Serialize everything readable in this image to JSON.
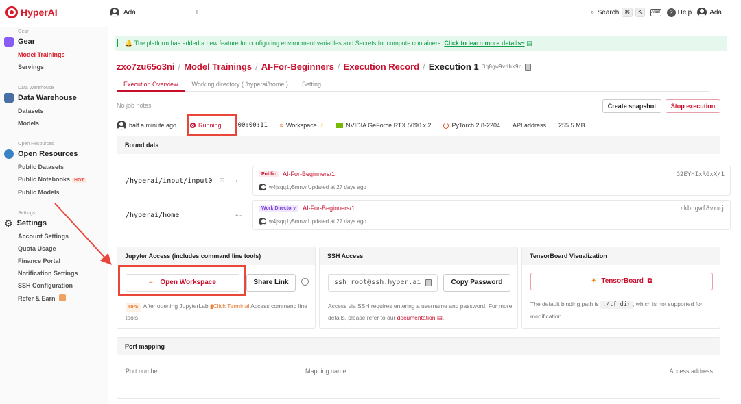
{
  "brand": {
    "name": "HyperAI"
  },
  "topbar": {
    "user": "Ada",
    "search_label": "Search",
    "shortcut_keys": [
      "⌘",
      "K"
    ],
    "help_label": "Help",
    "account_name": "Ada"
  },
  "sidebar": {
    "groups": [
      {
        "label": "Gear",
        "title": "Gear",
        "items": [
          "Model Trainings",
          "Servings"
        ],
        "active": "Model Trainings"
      },
      {
        "label": "Data Warehouse",
        "title": "Data Warehouse",
        "items": [
          "Datasets",
          "Models"
        ]
      },
      {
        "label": "Open Resources",
        "title": "Open Resources",
        "items": [
          "Public Datasets",
          "Public Notebooks",
          "Public Models"
        ],
        "hot_badge": "HOT"
      },
      {
        "label": "Settings",
        "title": "Settings",
        "items": [
          "Account Settings",
          "Quota Usage",
          "Finance Portal",
          "Notification Settings",
          "SSH Configuration",
          "Refer & Earn"
        ]
      }
    ]
  },
  "notice": {
    "text": "The platform has added a new feature for configuring environment variables and Secrets for compute containers.",
    "link": "Click to learn more details~"
  },
  "breadcrumb": {
    "items": [
      "zxo7zu65o3ni",
      "Model Trainings",
      "AI-For-Beginners",
      "Execution Record"
    ],
    "current": "Execution 1",
    "hash": "3q0gw9vdhk9c"
  },
  "tabs": [
    "Execution Overview",
    "Working directory ( /hyperai/home )",
    "Setting"
  ],
  "job_notes": "No job notes",
  "actions": {
    "snapshot": "Create snapshot",
    "stop": "Stop execution"
  },
  "status": {
    "time": "half a minute ago",
    "state": "Running",
    "elapsed": "00:00:11",
    "workspace": "Workspace",
    "gpu": "NVIDIA GeForce RTX 5090 x 2",
    "framework": "PyTorch 2.8-2204",
    "api": "API address",
    "size": "255.5 MB"
  },
  "bound_data": {
    "title": "Bound data",
    "rows": [
      {
        "path": "/hyperai/input/input0",
        "tag": "Public",
        "name": "AI-For-Beginners/1",
        "meta": "w4jsqq1y5mnw Updated at 27 days ago",
        "hash": "G2EYHIxR6xX/1"
      },
      {
        "path": "/hyperai/home",
        "tag": "Work Directory",
        "name": "AI-For-Beginners/1",
        "meta": "w4jsqq1y5mnw Updated at 27 days ago",
        "hash": "rkbqgwf8vrmj"
      }
    ]
  },
  "jupyter": {
    "title": "Jupyter Access (includes command line tools)",
    "open_label": "Open Workspace",
    "share_label": "Share Link",
    "tips_tag": "TIPS",
    "tips_before": "After opening JupyterLab",
    "tips_link": "Click Terminal",
    "tips_after": "Access command line tools"
  },
  "ssh": {
    "title": "SSH Access",
    "command": "ssh root@ssh.hyper.ai",
    "copy_label": "Copy Password",
    "help_before": "Access via SSH requires entering a username and password. For more details, please refer to our",
    "help_link": "documentation"
  },
  "tensorboard": {
    "title": "TensorBoard Visualization",
    "button": "TensorBoard",
    "help_before": "The default binding path is",
    "path": "./tf_dir",
    "help_after": ", which is not supported for modification."
  },
  "port_mapping": {
    "title": "Port mapping",
    "columns": [
      "Port number",
      "Mapping name",
      "Access address"
    ]
  },
  "colors": {
    "accent": "#c8102e",
    "highlight": "#e8473a",
    "notice_bg": "#e6f7ee",
    "notice_text": "#15a04e"
  }
}
